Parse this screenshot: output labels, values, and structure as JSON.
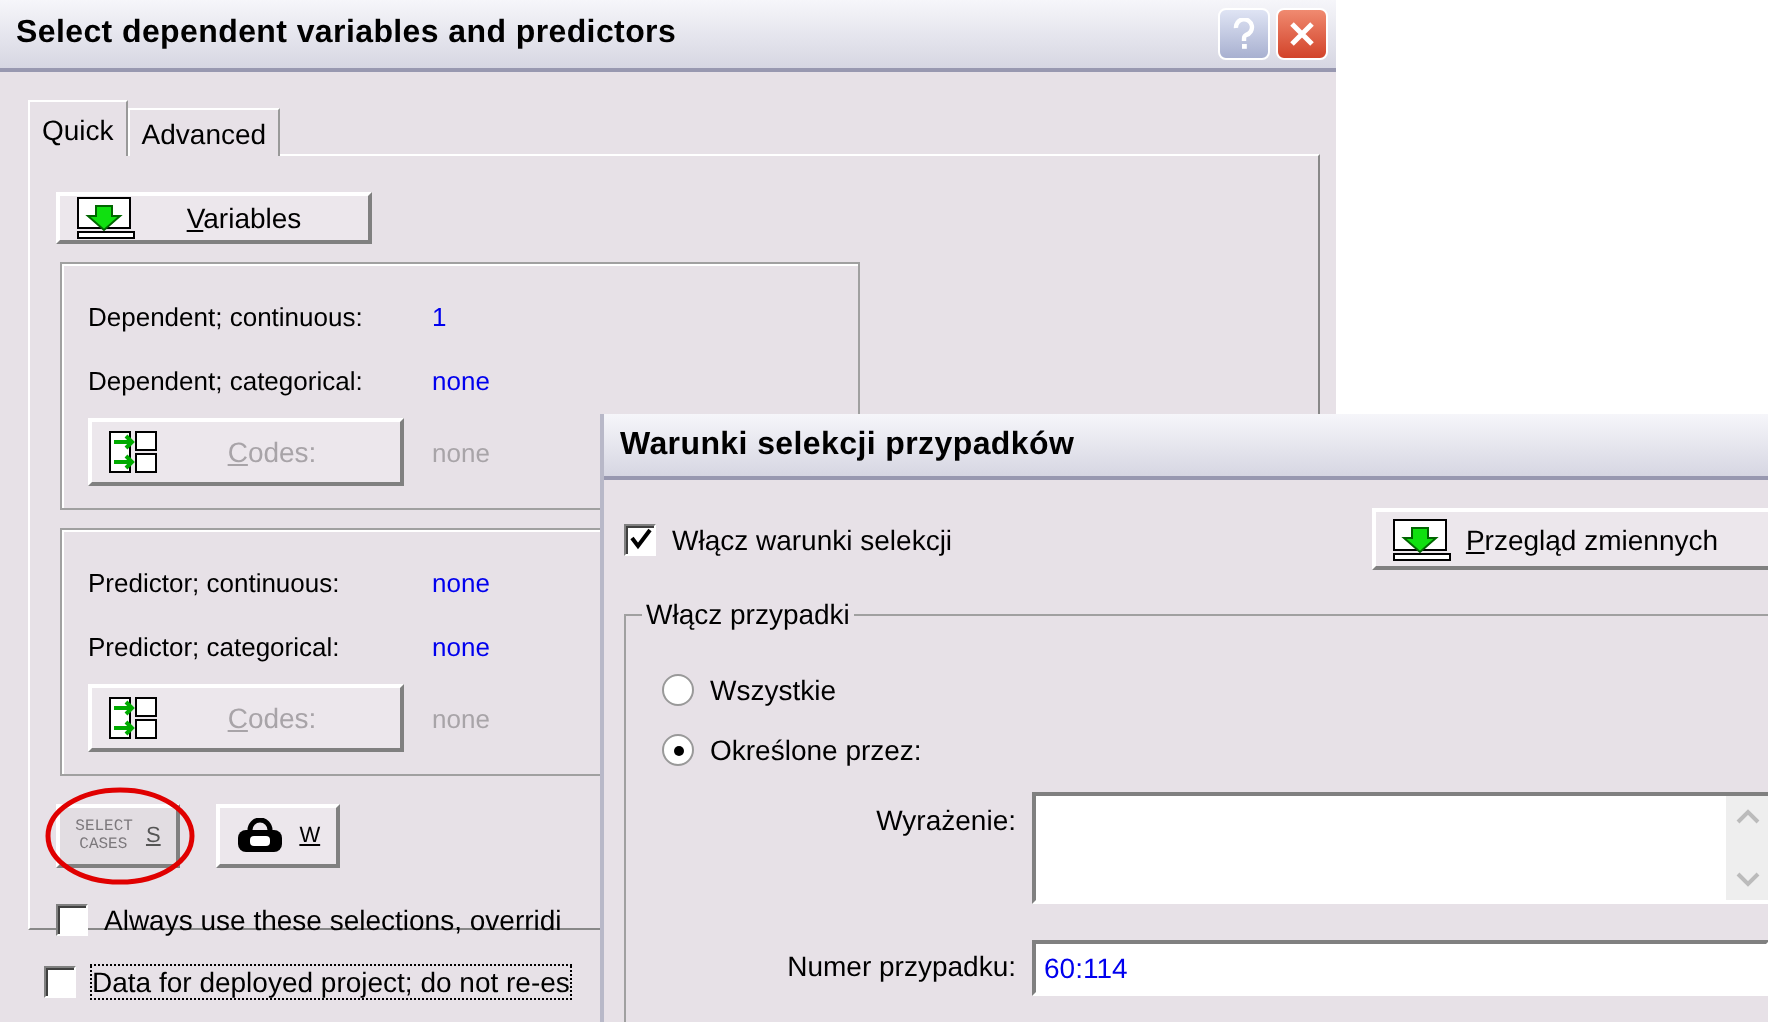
{
  "main_window": {
    "title": "Select dependent variables and predictors",
    "tabs": [
      {
        "label": "Quick",
        "selected": true
      },
      {
        "label": "Advanced",
        "selected": false
      }
    ],
    "variables_button": "Variables",
    "groups": [
      {
        "rows": [
          {
            "label": "Dependent; continuous:",
            "value": "1"
          },
          {
            "label": "Dependent; categorical:",
            "value": "none"
          }
        ],
        "codes_button": {
          "label": "Codes:",
          "disabled": true
        },
        "codes_value": "none"
      },
      {
        "rows": [
          {
            "label": "Predictor; continuous:",
            "value": "none"
          },
          {
            "label": "Predictor; categorical:",
            "value": "none"
          }
        ],
        "codes_button": {
          "label": "Codes:",
          "disabled": true
        },
        "codes_value": "none"
      }
    ],
    "select_cases_button": {
      "caption": "SELECT CASES",
      "key": "S",
      "disabled": true
    },
    "weight_button": {
      "key": "W"
    },
    "always_use": {
      "label": "Always use these selections, overridi",
      "checked": false
    },
    "deployed": {
      "label": "Data for deployed project; do not re-es",
      "checked": false
    }
  },
  "selection_window": {
    "title": "Warunki selekcji przypadków",
    "enable": {
      "label": "Włącz warunki selekcji",
      "checked": true
    },
    "browse_button": "Przegląd zmiennych",
    "group_label": "Włącz przypadki",
    "options": [
      {
        "label": "Wszystkie",
        "selected": false
      },
      {
        "label": "Określone przez:",
        "selected": true
      }
    ],
    "expression_label": "Wyrażenie:",
    "case_number_label": "Numer przypadku:",
    "case_number_value": "60:114"
  }
}
